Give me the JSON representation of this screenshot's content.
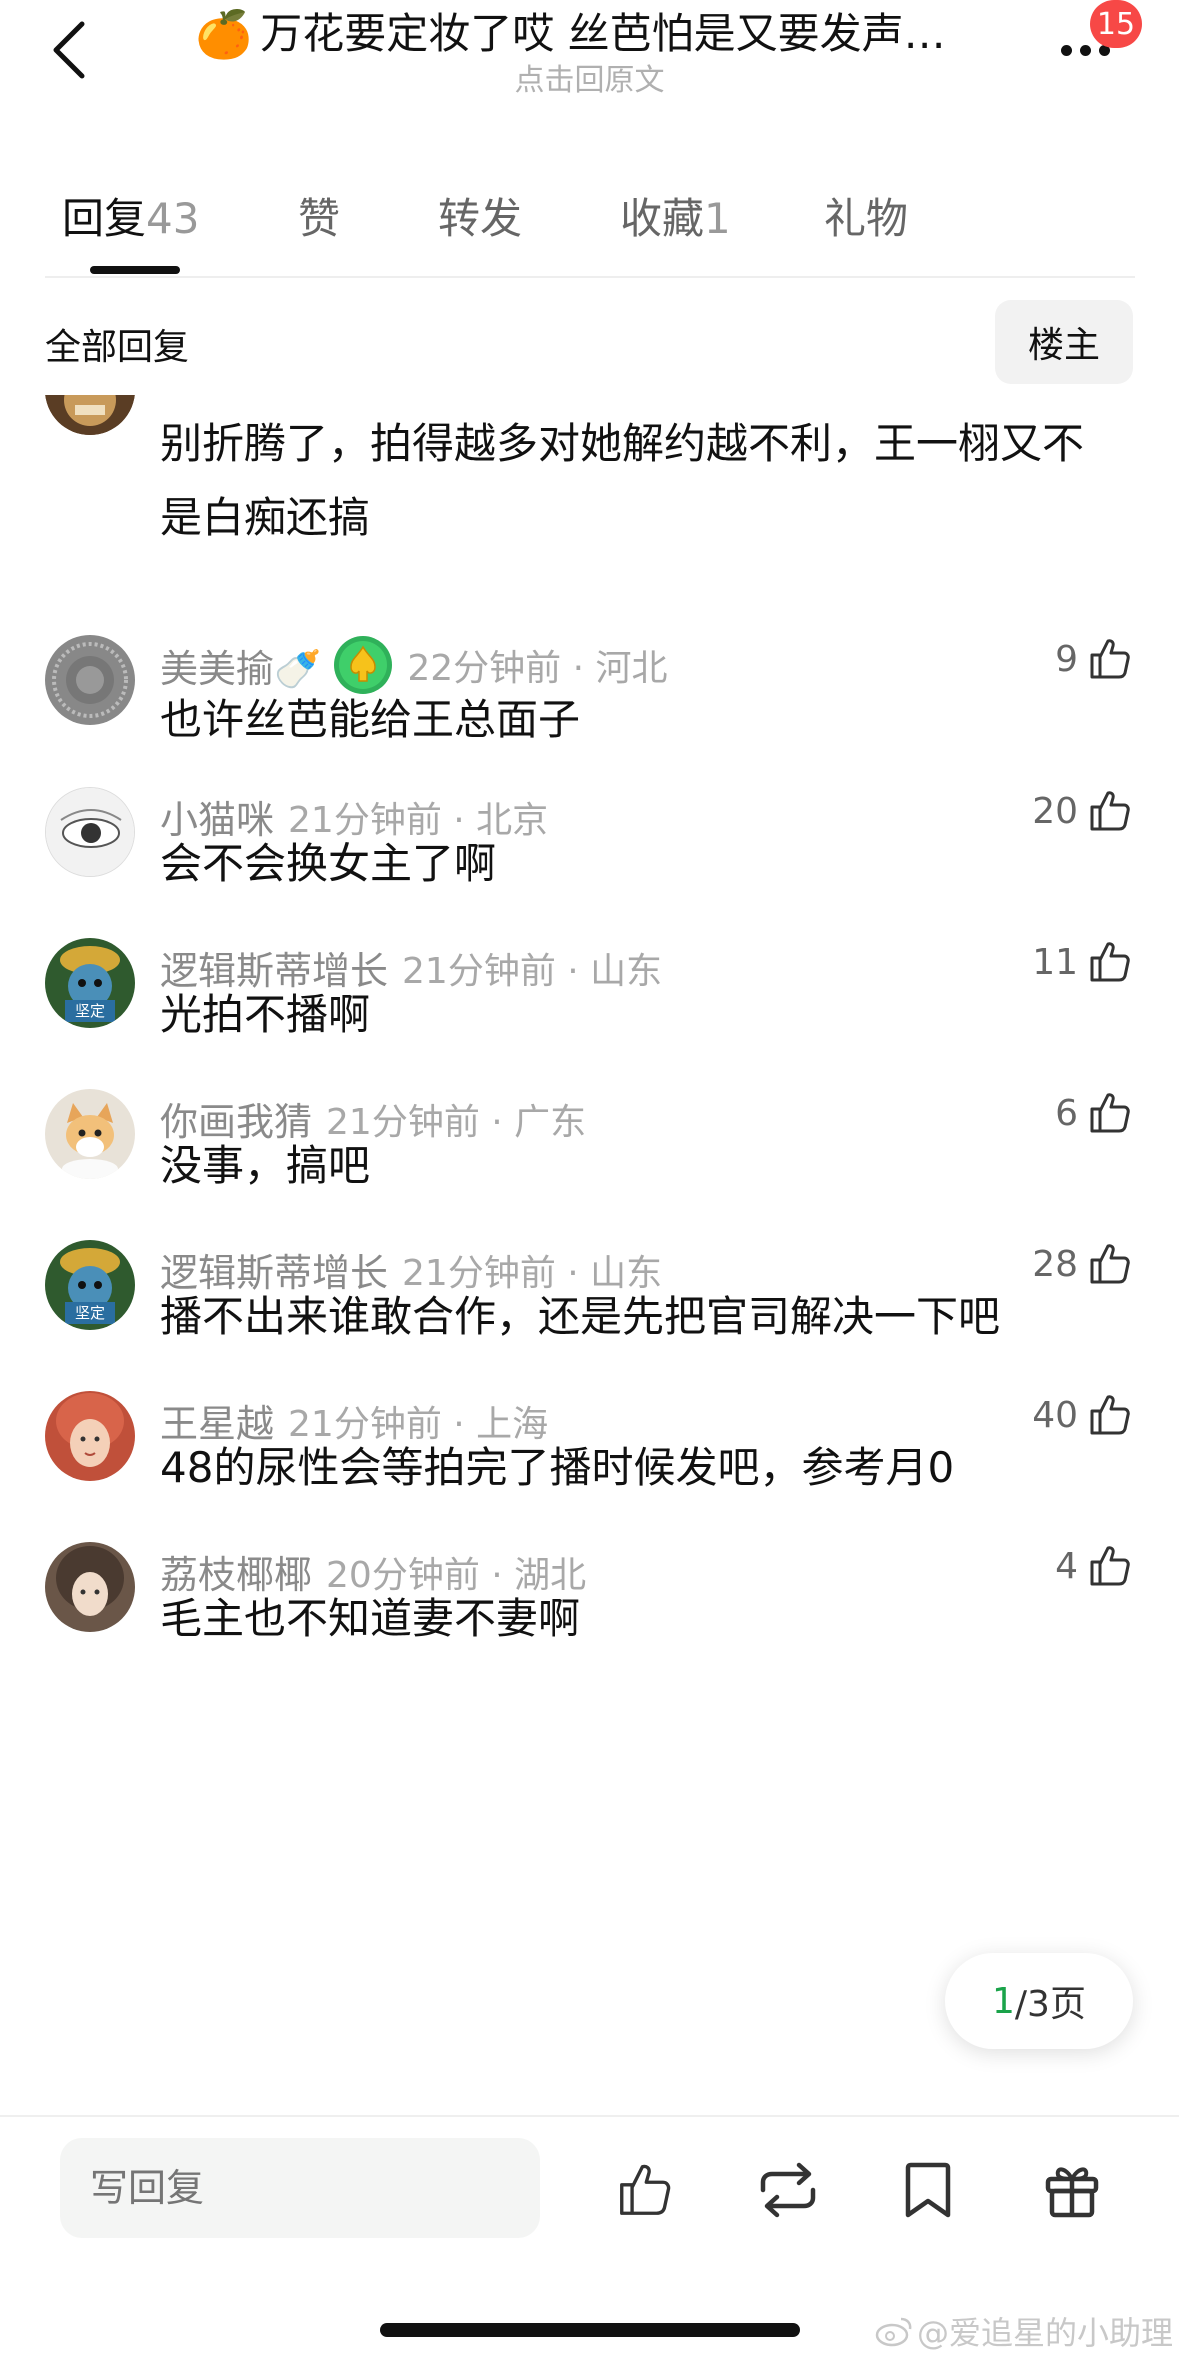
{
  "header": {
    "title_emoji": "🍊",
    "title": "万花要定妆了哎 丝芭怕是又要发声…",
    "subtitle": "点击回原文",
    "badge_count": "15"
  },
  "tabs": [
    {
      "label": "回复",
      "count": "43",
      "active": true
    },
    {
      "label": "赞",
      "count": ""
    },
    {
      "label": "转发",
      "count": ""
    },
    {
      "label": "收藏",
      "count": "1"
    },
    {
      "label": "礼物",
      "count": ""
    }
  ],
  "filter": {
    "label": "全部回复",
    "owner_button": "楼主"
  },
  "comments": [
    {
      "name": "",
      "meta": "",
      "text": "别折腾了，拍得越多对她解约越不利，王一栩又不是白痴还搞",
      "likes": ""
    },
    {
      "name": "美美揄🍼",
      "meta": "22分钟前 · 河北",
      "text": "也许丝芭能给王总面子",
      "likes": "9"
    },
    {
      "name": "小猫咪",
      "meta": "21分钟前 · 北京",
      "text": "会不会换女主了啊",
      "likes": "20"
    },
    {
      "name": "逻辑斯蒂增长",
      "meta": "21分钟前 · 山东",
      "text": "光拍不播啊",
      "likes": "11",
      "avatar_label": "坚定"
    },
    {
      "name": "你画我猜",
      "meta": "21分钟前 · 广东",
      "text": "没事，搞吧",
      "likes": "6"
    },
    {
      "name": "逻辑斯蒂增长",
      "meta": "21分钟前 · 山东",
      "text": "播不出来谁敢合作，还是先把官司解决一下吧",
      "likes": "28",
      "avatar_label": "坚定"
    },
    {
      "name": "王星越",
      "meta": "21分钟前 · 上海",
      "text": "48的尿性会等拍完了播时候发吧，参考月0",
      "likes": "40"
    },
    {
      "name": "荔枝椰椰",
      "meta": "20分钟前 · 湖北",
      "text": "毛主也不知道妻不妻啊",
      "likes": "4"
    }
  ],
  "pagination": {
    "current": "1",
    "rest": "/3页"
  },
  "bottom_bar": {
    "reply_placeholder": "写回复"
  },
  "watermark": "@爱追星的小助理",
  "colors": {
    "accent_green": "#1aa34a",
    "badge_red": "#f74846",
    "secondary_text": "#8a8a8a"
  }
}
